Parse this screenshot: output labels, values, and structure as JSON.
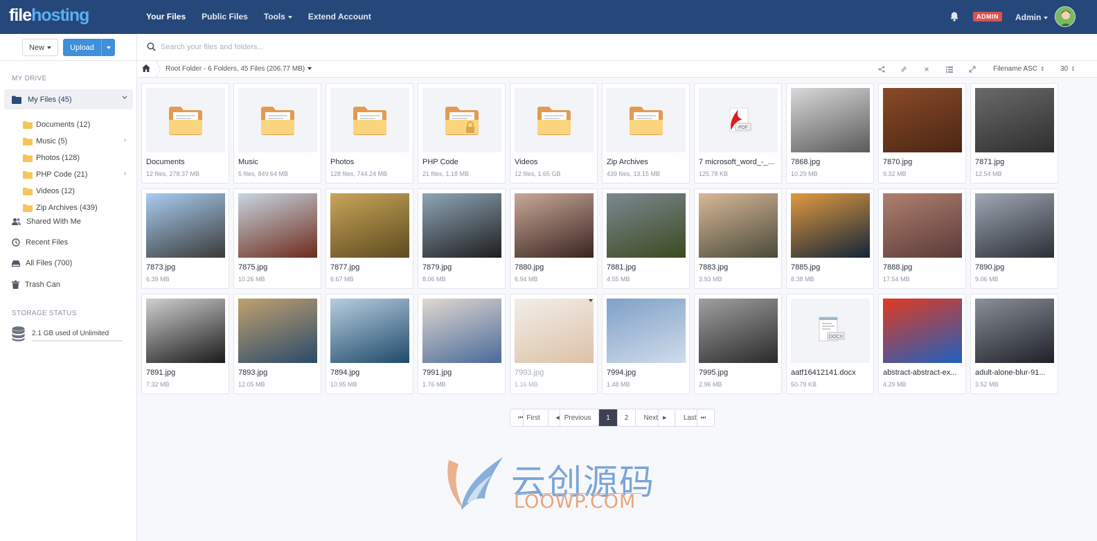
{
  "app": {
    "logo_part1": "file",
    "logo_part2": "hosting",
    "brand_color": "#26477a",
    "accent_color": "#3f8fd9"
  },
  "topnav": {
    "items": [
      "Your Files",
      "Public Files",
      "Tools",
      "Extend Account"
    ],
    "active_index": 0,
    "badge": "ADMIN",
    "user": "Admin"
  },
  "sidebar": {
    "new_label": "New",
    "upload_label": "Upload",
    "my_drive_heading": "MY DRIVE",
    "my_files_label": "My Files (45)",
    "folders": [
      {
        "label": "Documents (12)",
        "has_children": false
      },
      {
        "label": "Music (5)",
        "has_children": true
      },
      {
        "label": "Photos (128)",
        "has_children": false
      },
      {
        "label": "PHP Code (21)",
        "has_children": true
      },
      {
        "label": "Videos (12)",
        "has_children": false
      },
      {
        "label": "Zip Archives (439)",
        "has_children": false
      }
    ],
    "links": [
      {
        "label": "Shared With Me",
        "icon": "users-icon"
      },
      {
        "label": "Recent Files",
        "icon": "clock-icon"
      },
      {
        "label": "All Files (700)",
        "icon": "drive-icon"
      },
      {
        "label": "Trash Can",
        "icon": "trash-icon"
      }
    ],
    "storage_heading": "STORAGE STATUS",
    "storage_text": "2.1 GB used of Unlimited",
    "storage_fill_fraction": 0
  },
  "search": {
    "placeholder": "Search your files and folders..."
  },
  "breadcrumb": {
    "text": "Root Folder - 6 Folders, 45 Files (206.77 MB)",
    "sort": "Filename ASC",
    "per_page": "30"
  },
  "files": [
    {
      "name": "Documents",
      "meta": "12 files, 278.37 MB",
      "kind": "folder"
    },
    {
      "name": "Music",
      "meta": "5 files, 849.64 MB",
      "kind": "folder"
    },
    {
      "name": "Photos",
      "meta": "128 files, 744.24 MB",
      "kind": "folder"
    },
    {
      "name": "PHP Code",
      "meta": "21 files, 1.18 MB",
      "kind": "folder-locked"
    },
    {
      "name": "Videos",
      "meta": "12 files, 1.65 GB",
      "kind": "folder"
    },
    {
      "name": "Zip Archives",
      "meta": "439 files, 13.15 MB",
      "kind": "folder"
    },
    {
      "name": "7 microsoft_word_-_...",
      "meta": "125.78 KB",
      "kind": "pdf"
    },
    {
      "name": "7868.jpg",
      "meta": "10.29 MB",
      "kind": "image",
      "colors": [
        "#d9d9d9",
        "#5a5a5a"
      ]
    },
    {
      "name": "7870.jpg",
      "meta": "9.32 MB",
      "kind": "image",
      "colors": [
        "#8a4a28",
        "#4a2614"
      ]
    },
    {
      "name": "7871.jpg",
      "meta": "12.54 MB",
      "kind": "image",
      "colors": [
        "#6a6a6a",
        "#2e2e2e"
      ]
    },
    {
      "name": "7873.jpg",
      "meta": "6.39 MB",
      "kind": "image",
      "colors": [
        "#a9cdf0",
        "#3a3a3a"
      ]
    },
    {
      "name": "7875.jpg",
      "meta": "10.26 MB",
      "kind": "image",
      "colors": [
        "#c8d6e2",
        "#6e2a1a"
      ]
    },
    {
      "name": "7877.jpg",
      "meta": "6.67 MB",
      "kind": "image",
      "colors": [
        "#c9a55a",
        "#5c4a1e"
      ]
    },
    {
      "name": "7879.jpg",
      "meta": "8.06 MB",
      "kind": "image",
      "colors": [
        "#8fa6b8",
        "#1e1e1e"
      ]
    },
    {
      "name": "7880.jpg",
      "meta": "6.94 MB",
      "kind": "image",
      "colors": [
        "#c9a898",
        "#3a2420"
      ]
    },
    {
      "name": "7881.jpg",
      "meta": "4.55 MB",
      "kind": "image",
      "colors": [
        "#7d8890",
        "#3a4a20"
      ]
    },
    {
      "name": "7883.jpg",
      "meta": "3.93 MB",
      "kind": "image",
      "colors": [
        "#d8b898",
        "#4a4a3a"
      ]
    },
    {
      "name": "7885.jpg",
      "meta": "8.38 MB",
      "kind": "image",
      "colors": [
        "#e09a40",
        "#14243a"
      ]
    },
    {
      "name": "7888.jpg",
      "meta": "17.54 MB",
      "kind": "image",
      "colors": [
        "#b08070",
        "#5a3a38"
      ]
    },
    {
      "name": "7890.jpg",
      "meta": "9.06 MB",
      "kind": "image",
      "colors": [
        "#a0a8b4",
        "#2a2e36"
      ]
    },
    {
      "name": "7891.jpg",
      "meta": "7.32 MB",
      "kind": "image",
      "colors": [
        "#d0d0d0",
        "#1a1a1a"
      ]
    },
    {
      "name": "7893.jpg",
      "meta": "12.05 MB",
      "kind": "image",
      "colors": [
        "#c0a070",
        "#2a4a6a"
      ]
    },
    {
      "name": "7894.jpg",
      "meta": "10.95 MB",
      "kind": "image",
      "colors": [
        "#b8cde0",
        "#1e4a6a"
      ]
    },
    {
      "name": "7991.jpg",
      "meta": "1.76 MB",
      "kind": "image",
      "colors": [
        "#e0d8d0",
        "#4a6a9a"
      ]
    },
    {
      "name": "7993.jpg",
      "meta": "1.16 MB",
      "kind": "image",
      "colors": [
        "#e8e0d8",
        "#c09060"
      ],
      "dimmed": true
    },
    {
      "name": "7994.jpg",
      "meta": "1.48 MB",
      "kind": "image",
      "colors": [
        "#7ea0c8",
        "#d0dcea"
      ]
    },
    {
      "name": "7995.jpg",
      "meta": "2.96 MB",
      "kind": "image",
      "colors": [
        "#a0a0a0",
        "#2a2a2a"
      ]
    },
    {
      "name": "aatf16412141.docx",
      "meta": "50.79 KB",
      "kind": "docx"
    },
    {
      "name": "abstract-abstract-ex...",
      "meta": "4.29 MB",
      "kind": "image",
      "colors": [
        "#e03a20",
        "#2060c0"
      ]
    },
    {
      "name": "adult-alone-blur-91...",
      "meta": "3.52 MB",
      "kind": "image",
      "colors": [
        "#8a9098",
        "#1e2028"
      ]
    }
  ],
  "pagination": {
    "first": "First",
    "previous": "Previous",
    "pages": [
      "1",
      "2"
    ],
    "current": "1",
    "next": "Next",
    "last": "Last"
  },
  "watermark": {
    "cn": "云创源码",
    "en": "LOOWP.COM"
  }
}
